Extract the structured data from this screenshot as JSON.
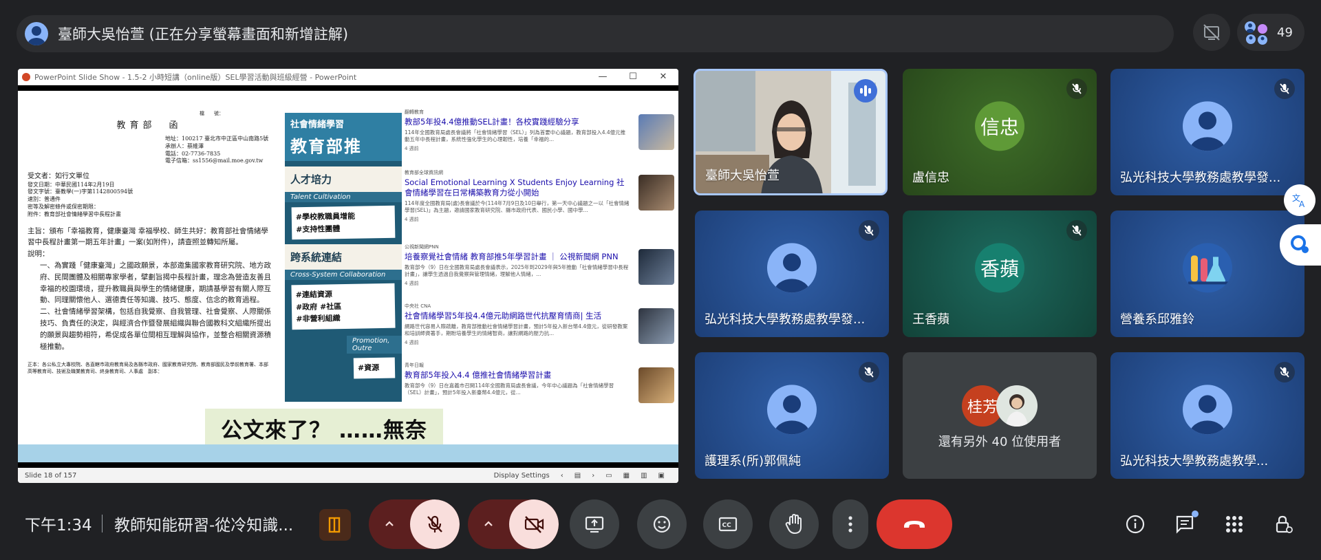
{
  "presenter": {
    "name": "臺師大吳怡萱 (正在分享螢幕畫面和新增註解)"
  },
  "top": {
    "people_count": "49"
  },
  "ppt": {
    "window_title": "PowerPoint Slide Show  -  1.5-2 小時短講（online版）SEL學習活動與班級經營 - PowerPoint",
    "status_left": "Slide 18 of 157",
    "display_settings": "Display Settings"
  },
  "doc": {
    "header_small": "檔　　號：",
    "title": "教育部　函",
    "meta": [
      "地址：100217 臺北市中正區中山南路5號",
      "承辦人：蔡維澤",
      "電話：02-7736-7835",
      "電子信箱：ss1556@mail.moe.gov.tw"
    ],
    "recipient": "受文者：如行文單位",
    "dispatch": [
      "發文日期：中華民國114年2月19日",
      "發文字號：臺教學(一)字第1142800594號",
      "速別：普通件",
      "密等及解密條件或保密期限：",
      "附件：教育部社會情緒學習中長程計畫"
    ],
    "subject": "主旨：頒布「幸福教育，健康臺灣 幸福學校、師生共好：教育部社會情緒學習中長程計畫第一期五年計畫」一案(如附件)，請查照並轉知所屬。",
    "explain_label": "說明：",
    "point1": "一、為實踐「健康臺灣」之國政願景，本部邀集國家教育研究院、地方政府、民間團體及相關專家學者，擘劃旨揭中長程計畫，理念為營造友善且幸福的校園環境，提升教職員與學生的情緒健康，期請基學習有關人際互動、同理關懷他人、選德責任等知識、技巧、態度、信念的教育過程。",
    "point2": "二、社會情緒學習架構，包括自我覺察、自我管理、社會覺察、人際關係技巧、負責任的決定，與經濟合作暨發展組織與聯合國教科文組織所提出的願景與趨勢相符，希促成各單位間相互理解與協作，並整合相關資源積極推動。",
    "footer": "正本：各公私立大專校院、各直轄市政府教育局及各縣市政府、國家教育研究院、教育部國民及學前教育署、本部高等教育司、技術及職業教育司、終身教育司、人事處　副本："
  },
  "poster": {
    "head_small": "社會情緒學習",
    "head_big": "教育部推",
    "sec1": "人才培力",
    "sec1_sub": "Talent Cultivation",
    "sec1_tags": [
      "#學校教職員增能",
      "#支持性團體"
    ],
    "sec2": "跨系統連結",
    "sec2_sub": "Cross-System Collaboration",
    "sec2_tags": [
      "#連結資源",
      "#政府 #社區",
      "#非營利組織"
    ],
    "sec3_sub": "Promotion, Outre",
    "sec3_tag": "#資源"
  },
  "news": [
    {
      "source": "翻轉教育",
      "title": "教部5年投4.4億推動SEL計畫！各校實踐經驗分享",
      "snippet": "114年全國教育局處長會議將「社會情緒學習（SEL）」列為首要中心議題，教育部投入4.4億元推動五年中長程計畫，系統性強化學生的心理韌性，培養「幸福的...",
      "time": "4 週前"
    },
    {
      "source": "教育部全球資訊網",
      "title": "Social Emotional Learning X Students Enjoy Learning 社會情緒學習在日常構築教育力從小開始",
      "snippet": "114年度全國教育局(處)長會議於今(114年7月9日及10日舉行，第一天中心議題之一以「社會情緒學習(SEL)」為主題，邀請國家教育研究院、縣市政府代表、國民小學、國中學...",
      "time": "4 週前"
    },
    {
      "source": "公視新聞網PNN",
      "title": "培養察覺社會情緒 教育部推5年學習計畫 ｜ 公視新聞網 PNN",
      "snippet": "教育部今（9）日在全國教育局處長會議表示，2025年到2029年與5年推動「社會情緒學習中長程計畫」，讓學生透過自我覺察與管理情緒，理解他人情緒，...",
      "time": "4 週前"
    },
    {
      "source": "中央社 CNA",
      "title": "社會情緒學習5年投4.4億元助網路世代抗壓育情商| 生活",
      "snippet": "網路世代容易人際疏離，教育部推動社會情緒學習計畫，預計5年投入新台幣4.4億元，從研發教案和培訓師資著手，期盼培養學生的情緒智商，讓對網路的壓力抗...",
      "time": "4 週前"
    },
    {
      "source": "青年日報",
      "title": "教育部5年投入4.4 億推社會情緒學習計畫",
      "snippet": "教育部今（9）日在嘉義市召開114年全國教育局處長會議，今年中心議題為「社會情緒學習（SEL）計畫」，預計5年投入新臺幣4.4億元，從...",
      "time": ""
    }
  ],
  "caption": "公文來了？ ……無奈",
  "tiles": [
    {
      "name": "臺師大吳怡萱",
      "type": "video"
    },
    {
      "name": "盧信忠",
      "initials": "信忠",
      "type": "initials"
    },
    {
      "name": "弘光科技大學教務處教學發...",
      "type": "user"
    },
    {
      "name": "弘光科技大學教務處教學發...",
      "type": "user"
    },
    {
      "name": "王香蘋",
      "initials": "香蘋",
      "type": "initials"
    },
    {
      "name": "營養系邱雅鈴",
      "type": "image"
    },
    {
      "name": "護理系(所)郭佩純",
      "type": "user"
    },
    {
      "initials": "桂芳",
      "more_text": "還有另外 40 位使用者",
      "type": "more"
    },
    {
      "name": "弘光科技大學教務處教學...",
      "type": "user"
    }
  ],
  "bottom": {
    "time": "下午1:34",
    "meeting_title": "教師知能研習-從冷知識..."
  },
  "colors": {
    "background": "#202124",
    "end_call": "#dc362e",
    "muted_red": "#f9dedc",
    "accent_blue": "#8ab4f8"
  },
  "icons": {
    "presenter": "user-avatar-icon",
    "no_present": "present-off-icon",
    "people": "people-icon",
    "mic": "mic-off-icon",
    "camera": "videocam-off-icon",
    "present": "present-to-all-icon",
    "emoji": "emoji-icon",
    "captions": "closed-caption-icon",
    "hand": "raise-hand-icon",
    "more": "more-vert-icon",
    "end": "call-end-icon",
    "info": "info-icon",
    "chat": "chat-icon",
    "apps": "apps-icon",
    "host": "host-controls-icon"
  }
}
